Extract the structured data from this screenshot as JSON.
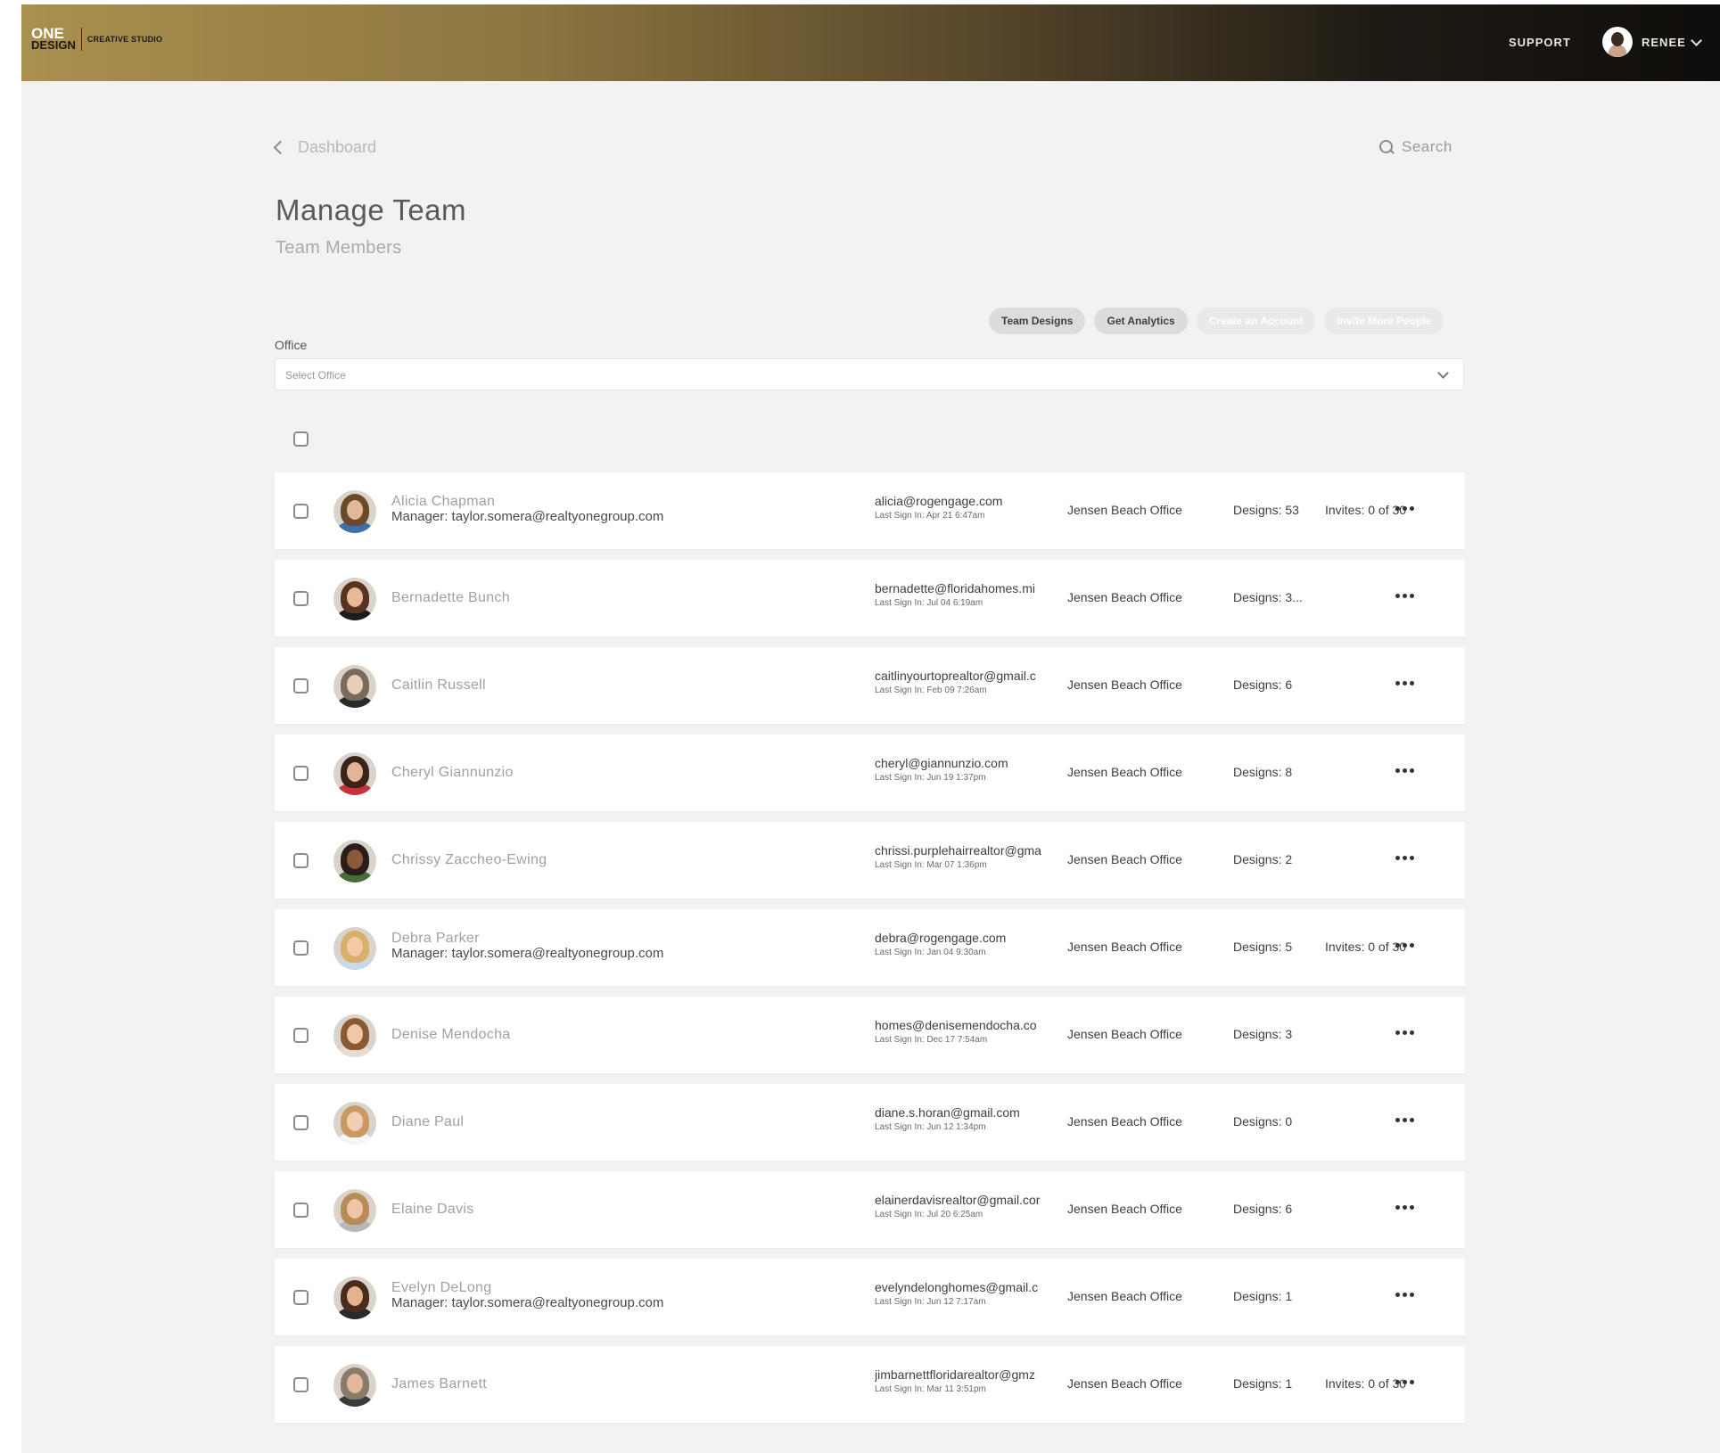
{
  "brand": {
    "logo_top": "ONE",
    "logo_bottom": "DESIGN",
    "logo_sub": "CREATIVE STUDIO"
  },
  "header": {
    "support_label": "SUPPORT",
    "user_name": "RENEE"
  },
  "nav": {
    "back_label": "Dashboard",
    "search_label": "Search"
  },
  "page": {
    "title": "Manage Team",
    "subtitle": "Team Members"
  },
  "actions": {
    "team_designs": "Team Designs",
    "get_analytics": "Get Analytics",
    "create_account": "Create an Account",
    "invite_more": "Invite More People"
  },
  "filter": {
    "office_label": "Office",
    "office_placeholder": "Select Office"
  },
  "members": [
    {
      "name": "Alicia Chapman",
      "manager": "Manager: taylor.somera@realtyonegroup.com",
      "email": "alicia@rogengage.com",
      "last_sign_in": "Last Sign In: Apr 21 6:47am",
      "office": "Jensen Beach Office",
      "designs": "Designs: 53",
      "invites": "Invites: 0 of 30",
      "hair": "#6b4a2a",
      "skin": "#e2b79a",
      "shirt": "#3d6fa8"
    },
    {
      "name": "Bernadette Bunch",
      "manager": "",
      "email": "bernadette@floridahomes.mi",
      "last_sign_in": "Last Sign In: Jul 04 6:19am",
      "office": "Jensen Beach Office",
      "designs": "Designs: 3...",
      "invites": "",
      "hair": "#5a3320",
      "skin": "#e7b996",
      "shirt": "#1c1c1c"
    },
    {
      "name": "Caitlin Russell",
      "manager": "",
      "email": "caitlinyourtoprealtor@gmail.c",
      "last_sign_in": "Last Sign In: Feb 09 7:26am",
      "office": "Jensen Beach Office",
      "designs": "Designs: 6",
      "invites": "",
      "hair": "#7a6a5c",
      "skin": "#e9cdb7",
      "shirt": "#2a2a2a"
    },
    {
      "name": "Cheryl Giannunzio",
      "manager": "",
      "email": "cheryl@giannunzio.com",
      "last_sign_in": "Last Sign In: Jun 19 1:37pm",
      "office": "Jensen Beach Office",
      "designs": "Designs: 8",
      "invites": "",
      "hair": "#3a2418",
      "skin": "#e3b495",
      "shirt": "#c8323c"
    },
    {
      "name": "Chrissy Zaccheo-Ewing",
      "manager": "",
      "email": "chrissi.purplehairrealtor@gma",
      "last_sign_in": "Last Sign In: Mar 07 1:36pm",
      "office": "Jensen Beach Office",
      "designs": "Designs: 2",
      "invites": "",
      "hair": "#2a1e1a",
      "skin": "#8a5a3a",
      "shirt": "#4a6b3a"
    },
    {
      "name": "Debra Parker",
      "manager": "Manager: taylor.somera@realtyonegroup.com",
      "email": "debra@rogengage.com",
      "last_sign_in": "Last Sign In: Jan 04 9:30am",
      "office": "Jensen Beach Office",
      "designs": "Designs: 5",
      "invites": "Invites: 0 of 30",
      "hair": "#d7b06a",
      "skin": "#f1cba8",
      "shirt": "#c9d9e6"
    },
    {
      "name": "Denise Mendocha",
      "manager": "",
      "email": "homes@denisemendocha.co",
      "last_sign_in": "Last Sign In: Dec 17 7:54am",
      "office": "Jensen Beach Office",
      "designs": "Designs: 3",
      "invites": "",
      "hair": "#8a5a34",
      "skin": "#f0c8a8",
      "shirt": "#e8dcd0"
    },
    {
      "name": "Diane Paul",
      "manager": "",
      "email": "diane.s.horan@gmail.com",
      "last_sign_in": "Last Sign In: Jun 12 1:34pm",
      "office": "Jensen Beach Office",
      "designs": "Designs: 0",
      "invites": "",
      "hair": "#c89a62",
      "skin": "#f1cfb2",
      "shirt": "#f5f5f5"
    },
    {
      "name": "Elaine Davis",
      "manager": "",
      "email": "elainerdavisrealtor@gmail.cor",
      "last_sign_in": "Last Sign In: Jul 20 6:25am",
      "office": "Jensen Beach Office",
      "designs": "Designs: 6",
      "invites": "",
      "hair": "#b98a5a",
      "skin": "#eec6a6",
      "shirt": "#b8b8b8"
    },
    {
      "name": "Evelyn DeLong",
      "manager": "Manager: taylor.somera@realtyonegroup.com",
      "email": "evelyndelonghomes@gmail.c",
      "last_sign_in": "Last Sign In: Jun 12 7:17am",
      "office": "Jensen Beach Office",
      "designs": "Designs: 1",
      "invites": "",
      "hair": "#4a2c1c",
      "skin": "#e2b48e",
      "shirt": "#2a2a2a"
    },
    {
      "name": "James Barnett",
      "manager": "",
      "email": "jimbarnettfloridarealtor@gmz",
      "last_sign_in": "Last Sign In: Mar 11 3:51pm",
      "office": "Jensen Beach Office",
      "designs": "Designs: 1",
      "invites": "Invites: 0 of 30",
      "hair": "#8a7a6a",
      "skin": "#e0b89a",
      "shirt": "#3a3a3a"
    }
  ]
}
